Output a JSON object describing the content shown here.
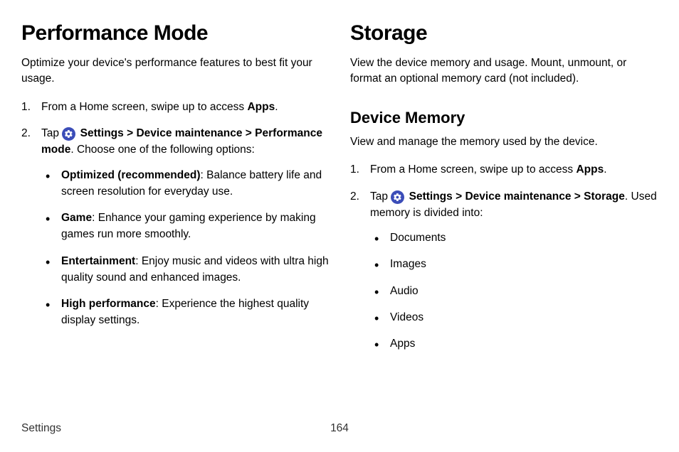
{
  "left": {
    "heading": "Performance Mode",
    "intro": "Optimize your device's performance features to best fit your usage.",
    "step1_pre": "From a Home screen, swipe up to access ",
    "step1_bold": "Apps",
    "step1_post": ".",
    "step2_tap": "Tap ",
    "step2_settings": "Settings",
    "step2_sep1": " > ",
    "step2_devmaint": "Device maintenance",
    "step2_sep2": " > ",
    "step2_perfmode": "Performance mode",
    "step2_rest": ". Choose one of the following options:",
    "opt1_b": "Optimized (recommended)",
    "opt1_t": ": Balance battery life and screen resolution for everyday use.",
    "opt2_b": "Game",
    "opt2_t": ": Enhance your gaming experience by making games run more smoothly.",
    "opt3_b": "Entertainment",
    "opt3_t": ": Enjoy music and videos with ultra high quality sound and enhanced images.",
    "opt4_b": "High performance",
    "opt4_t": ": Experience the highest quality display settings."
  },
  "right": {
    "heading": "Storage",
    "intro": "View the device memory and usage. Mount, unmount, or format an optional memory card (not included).",
    "subheading": "Device Memory",
    "subintro": "View and manage the memory used by the device.",
    "step1_pre": "From a Home screen, swipe up to access ",
    "step1_bold": "Apps",
    "step1_post": ".",
    "step2_tap": "Tap ",
    "step2_settings": "Settings",
    "step2_sep1": " > ",
    "step2_devmaint": "Device maintenance",
    "step2_sep2": " > ",
    "step2_storage": "Storage",
    "step2_rest": ". Used memory is divided into:",
    "items": {
      "0": "Documents",
      "1": "Images",
      "2": "Audio",
      "3": "Videos",
      "4": "Apps"
    }
  },
  "footer": {
    "section": "Settings",
    "page": "164"
  }
}
